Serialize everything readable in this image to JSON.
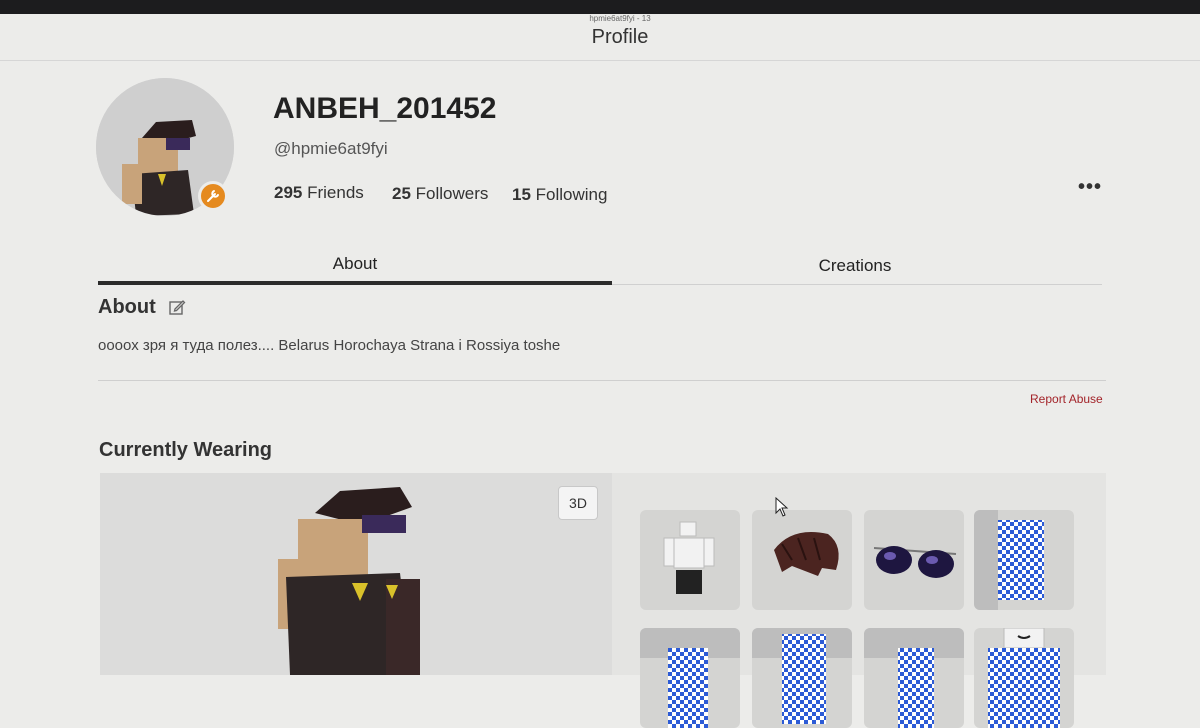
{
  "window": {
    "caption": "hpmie6at9fyi - 13",
    "heading": "Profile"
  },
  "profile": {
    "display_name": "ANBEH_201452",
    "username": "@hpmie6at9fyi",
    "stats": {
      "friends_count": "295",
      "friends_label": "Friends",
      "followers_count": "25",
      "followers_label": "Followers",
      "following_count": "15",
      "following_label": "Following"
    },
    "more_label": "•••"
  },
  "tabs": [
    {
      "label": "About",
      "active": true
    },
    {
      "label": "Creations",
      "active": false
    }
  ],
  "about": {
    "heading": "About",
    "bio": "оооох зря я туда полез.... Belarus Horochaya Strana i Rossiya toshe",
    "report_label": "Report Abuse"
  },
  "wearing": {
    "heading": "Currently Wearing",
    "view_toggle_label": "3D",
    "items": [
      {
        "icon": "shirt-item-icon"
      },
      {
        "icon": "hair-item-icon"
      },
      {
        "icon": "sunglasses-item-icon"
      },
      {
        "icon": "checkered-pants-item-icon"
      },
      {
        "icon": "checkered-pants-item-icon"
      },
      {
        "icon": "checkered-pants-item-icon"
      },
      {
        "icon": "checkered-pants-item-icon"
      },
      {
        "icon": "checkered-shirt-item-icon"
      }
    ]
  },
  "colors": {
    "accent_badge": "#e58a1f",
    "report_link": "#a3242a",
    "tab_indicator": "#2b2b2b"
  }
}
